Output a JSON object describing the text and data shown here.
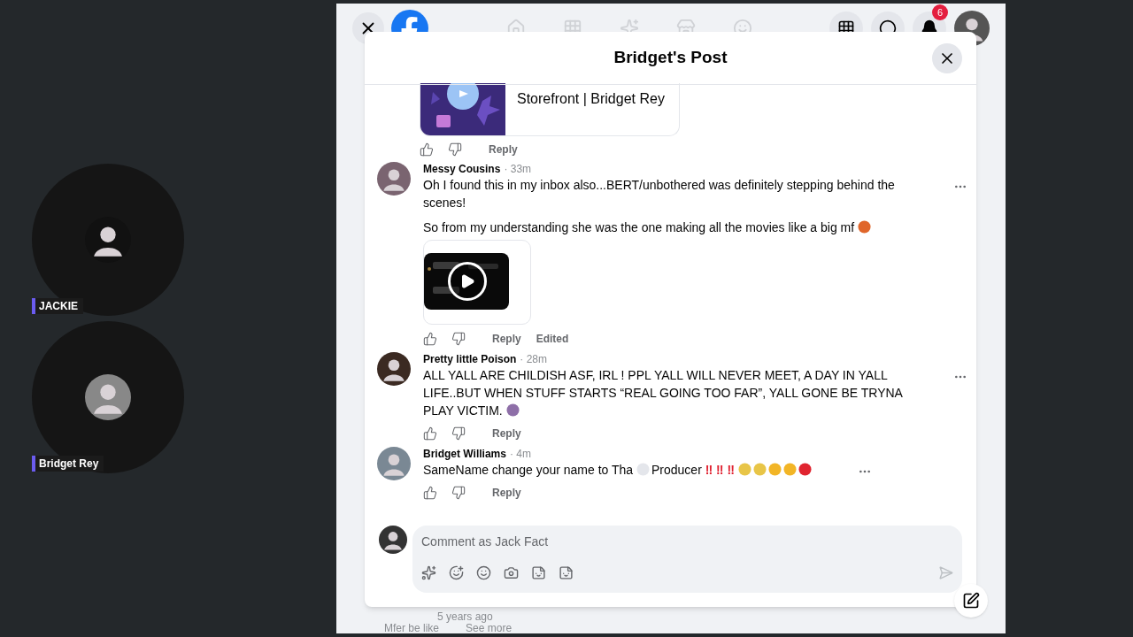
{
  "speakers": [
    {
      "name": "JACKIE"
    },
    {
      "name": "Bridget Rey"
    }
  ],
  "topbar": {
    "notification_count": "6"
  },
  "modal": {
    "title": "Bridget's Post"
  },
  "link_preview": {
    "title": "Storefront | Bridget Rey",
    "actions": [
      "Reply"
    ]
  },
  "comments": [
    {
      "author": "Messy Cousins",
      "time": "· 33m",
      "paragraphs": [
        [
          {
            "kind": "text",
            "text": "Oh I found this in my inbox also...BERT/unbothered was definitely stepping behind the scenes!"
          }
        ],
        [
          {
            "kind": "text",
            "text": "So from my understanding she was the one making all the movies like a big mf"
          },
          {
            "kind": "emoji",
            "color": "#e0662b"
          }
        ]
      ],
      "video": true,
      "actions": [
        "Reply",
        "Edited"
      ]
    },
    {
      "author": "Pretty little Poison",
      "time": "· 28m",
      "paragraphs": [
        [
          {
            "kind": "text",
            "text": "ALL YALL ARE CHILDISH ASF, IRL ! PPL YALL WILL NEVER MEET, A DAY IN YALL LIFE..BUT WHEN STUFF STARTS “REAL GOING TOO FAR”, YALL GONE BE TRYNA PLAY VICTIM."
          },
          {
            "kind": "emoji",
            "color": "#8e6fa8"
          }
        ]
      ],
      "video": false,
      "actions": [
        "Reply"
      ]
    },
    {
      "author": "Bridget Williams",
      "time": "· 4m",
      "paragraphs": [
        [
          {
            "kind": "text",
            "text": "SameName change your name to Tha"
          },
          {
            "kind": "emoji",
            "color": "#e4e6eb"
          },
          {
            "kind": "text",
            "text": "Producer"
          },
          {
            "kind": "mark",
            "text": "‼ ‼ ‼"
          },
          {
            "kind": "emoji",
            "color": "#e8c547"
          },
          {
            "kind": "emoji",
            "color": "#e8c547"
          },
          {
            "kind": "emoji",
            "color": "#f2b526"
          },
          {
            "kind": "emoji",
            "color": "#f2b526"
          },
          {
            "kind": "emoji",
            "color": "#e0242f"
          }
        ]
      ],
      "video": false,
      "actions": [
        "Reply"
      ]
    }
  ],
  "composer": {
    "placeholder": "Comment as Jack Fact"
  },
  "background_post": {
    "time": "5 years ago",
    "text": "Mfer be like",
    "link": "See more"
  }
}
